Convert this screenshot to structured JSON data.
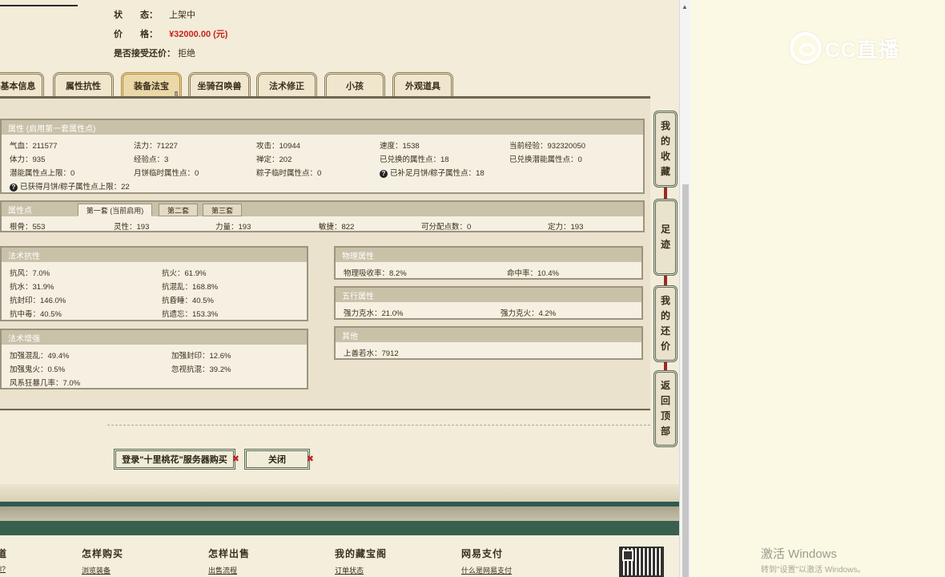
{
  "info": {
    "status_label": "状　　态：",
    "status_value": "上架中",
    "price_label": "价　　格：",
    "price_value": "¥32000.00 (元)",
    "bargain_label": "是否接受还价：",
    "bargain_value": "拒绝"
  },
  "tabs": [
    {
      "label": "基本信息"
    },
    {
      "label": "属性抗性"
    },
    {
      "label": "装备法宝"
    },
    {
      "label": "坐骑召唤兽"
    },
    {
      "label": "法术修正"
    },
    {
      "label": "小孩"
    },
    {
      "label": "外观道具"
    }
  ],
  "attr": {
    "title": "属性 (启用第一套属性点)",
    "rows": [
      [
        "气血：211577",
        "法力：71227",
        "攻击：10944",
        "速度：1538",
        "当前经验：932320050"
      ],
      [
        "体力：935",
        "经验点：3",
        "禅定：202",
        "已兑换的属性点：18",
        "已兑换潜能属性点：0"
      ],
      [
        "潜能属性点上限：0",
        "月饼临时属性点：0",
        "粽子临时属性点：0",
        "已补足月饼/粽子属性点：18",
        ""
      ]
    ],
    "last": "已获得月饼/粽子属性点上限：22"
  },
  "points": {
    "title": "属性点",
    "subtabs": [
      "第一套 (当前启用)",
      "第二套",
      "第三套"
    ],
    "values": [
      "根骨：553",
      "灵性：193",
      "力量：193",
      "敏捷：822",
      "可分配点数：0",
      "定力：193"
    ]
  },
  "resist": {
    "title": "法术抗性",
    "left": [
      "抗风：7.0%",
      "抗水：31.9%",
      "抗封印：146.0%",
      "抗中毒：40.5%"
    ],
    "right": [
      "抗火：61.9%",
      "抗混乱：168.8%",
      "抗昏睡：40.5%",
      "抗遗忘：153.3%"
    ]
  },
  "enhance": {
    "title": "法术增强",
    "left": [
      "加强混乱：49.4%",
      "加强鬼火：0.5%",
      "风系狂暴几率：7.0%"
    ],
    "right": [
      "加强封印：12.6%",
      "忽视抗混：39.2%"
    ]
  },
  "physical": {
    "title": "物理属性",
    "values": [
      "物理吸收率：8.2%",
      "命中率：10.4%"
    ]
  },
  "five": {
    "title": "五行属性",
    "values": [
      "强力克水：21.0%",
      "强力克火：4.2%"
    ]
  },
  "other": {
    "title": "其他",
    "values": [
      "上善若水：7912"
    ]
  },
  "side": {
    "fav": [
      "我",
      "的",
      "收",
      "藏"
    ],
    "trail": [
      "足",
      "迹"
    ],
    "bargain": [
      "我",
      "的",
      "还",
      "价"
    ],
    "top": [
      "返",
      "回",
      "顶",
      "部"
    ]
  },
  "buttons": {
    "login": "登录\"十里桃花\"服务器购买",
    "close": "关闭"
  },
  "footer": {
    "col0_title": "道",
    "col0_link": "l?",
    "col1_title": "怎样购买",
    "col1_link": "浏览装备",
    "col2_title": "怎样出售",
    "col2_link": "出售流程",
    "col3_title": "我的藏宝阁",
    "col3_link": "订单状态",
    "col4_title": "网易支付",
    "col4_link": "什么是网易支付"
  },
  "watermark": "CC直播",
  "windows": {
    "line1": "激活 Windows",
    "line2": "转到\"设置\"以激活 Windows。"
  },
  "colors": {
    "price": "#c8221a",
    "accent": "#2f5a4e",
    "header": "#c9c1a8"
  }
}
